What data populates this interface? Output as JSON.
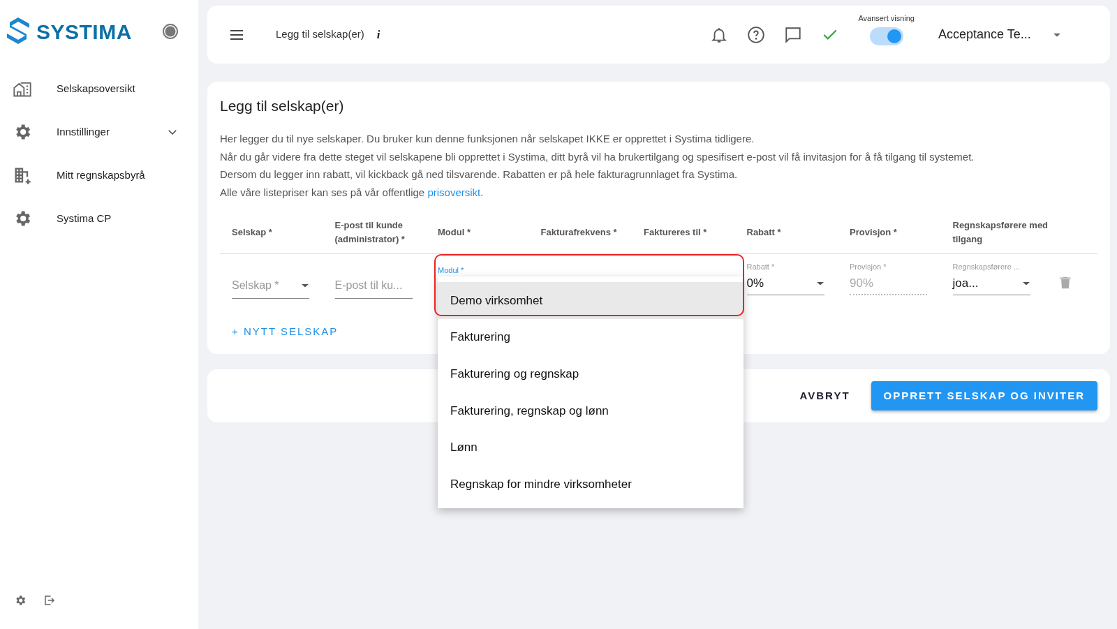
{
  "sidebar": {
    "logo": "SYSTIMA",
    "items": [
      {
        "label": "Selskapsoversikt",
        "expandable": false
      },
      {
        "label": "Innstillinger",
        "expandable": true
      },
      {
        "label": "Mitt regnskapsbyrå",
        "expandable": false
      },
      {
        "label": "Systima CP",
        "expandable": false
      }
    ]
  },
  "topbar": {
    "title": "Legg til selskap(er)",
    "info": "i",
    "toggle_label": "Avansert visning",
    "toggle_on": true,
    "account": "Acceptance Te..."
  },
  "form": {
    "heading": "Legg til selskap(er)",
    "paragraphs": [
      "Her legger du til nye selskaper. Du bruker kun denne funksjonen når selskapet IKKE er opprettet i Systima tidligere.",
      "Når du går videre fra dette steget vil selskapene bli opprettet i Systima, ditt byrå vil ha brukertilgang og spesifisert e-post vil få invitasjon for å få tilgang til systemet.",
      "Dersom du legger inn rabatt, vil kickback gå ned tilsvarende. Rabatten er på hele fakturagrunnlaget fra Systima."
    ],
    "price_note": {
      "text": "Alle våre listepriser kan ses på vår offentlige ",
      "link": "prisoversikt",
      "end": "."
    },
    "columns": [
      "Selskap *",
      "E-post til kunde (administrator) *",
      "Modul *",
      "Fakturafrekvens *",
      "Faktureres til *",
      "Rabatt *",
      "Provisjon *",
      "Regnskapsførere med tilgang"
    ],
    "fields": [
      {
        "kind": "select",
        "placeholder": "Selskap *"
      },
      {
        "kind": "text",
        "placeholder": "E-post til ku..."
      },
      {
        "kind": "menu",
        "label": "Modul *",
        "options": [
          {
            "label": "Demo virksomhet",
            "selected": true
          },
          {
            "label": "Fakturering",
            "selected": false
          },
          {
            "label": "Fakturering og regnskap",
            "selected": false
          },
          {
            "label": "Fakturering, regnskap og lønn",
            "selected": false
          },
          {
            "label": "Lønn",
            "selected": false
          },
          {
            "label": "Regnskap for mindre virksomheter",
            "selected": false
          }
        ]
      },
      {
        "kind": "select",
        "label": "Rabatt *",
        "value": "0%"
      },
      {
        "kind": "readonly",
        "label": "Provisjon *",
        "value": "90%"
      },
      {
        "kind": "select",
        "label": "Regnskapsførere ...",
        "value": "joa..."
      }
    ],
    "add_button": "+ NYTT SELSKAP"
  },
  "footer": {
    "cancel": "AVBRYT",
    "submit": "OPPRETT SELSKAP OG INVITER"
  }
}
